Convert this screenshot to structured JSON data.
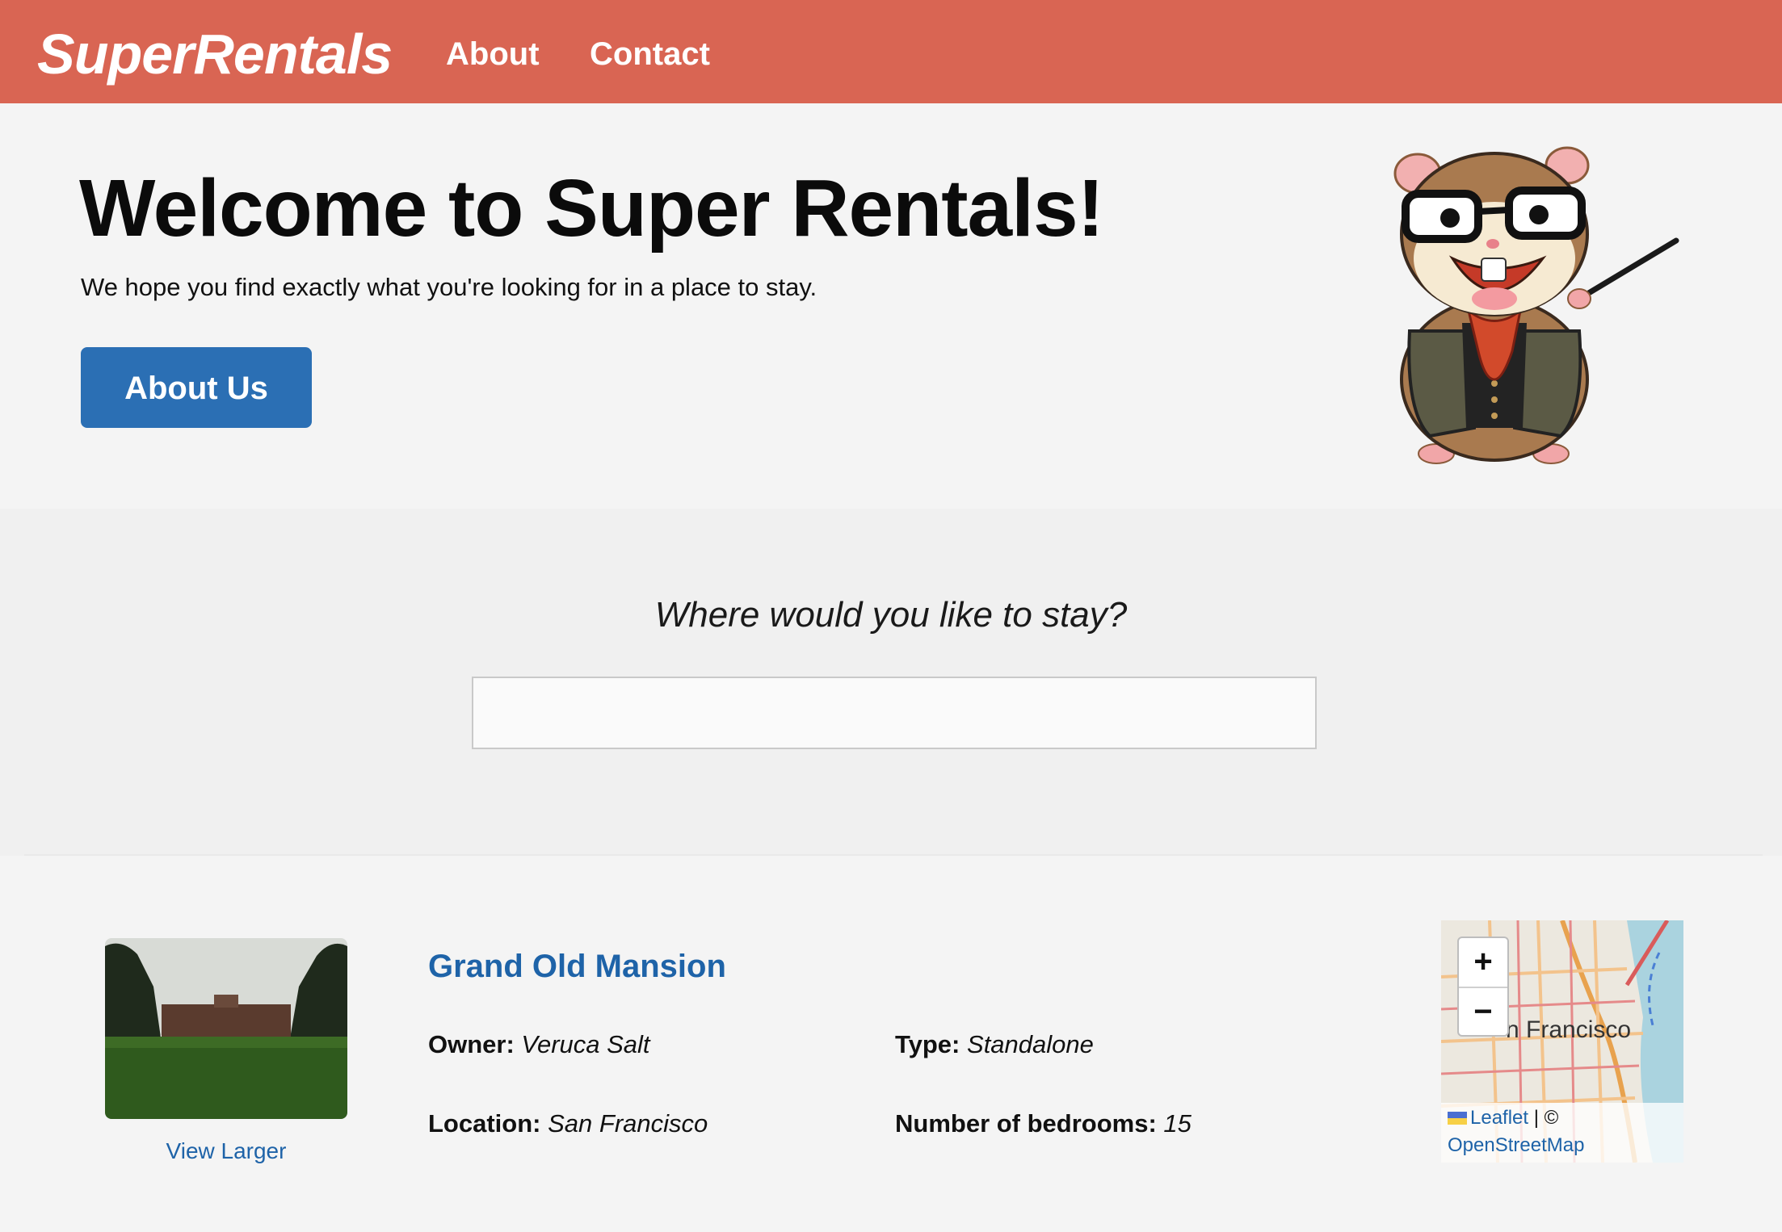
{
  "header": {
    "brand": "SuperRentals",
    "nav": [
      {
        "label": "About"
      },
      {
        "label": "Contact"
      }
    ],
    "bar_color": "#d96553"
  },
  "hero": {
    "title": "Welcome to Super Rentals!",
    "subtitle": "We hope you find exactly what you're looking for in a place to stay.",
    "button_label": "About Us",
    "button_color": "#2b6fb4",
    "mascot_icon": "tomster-mascot-illustration"
  },
  "search": {
    "prompt": "Where would you like to stay?",
    "value": "",
    "placeholder": ""
  },
  "rentals": [
    {
      "title": "Grand Old Mansion",
      "image_action": "View Larger",
      "owner_label": "Owner:",
      "owner": "Veruca Salt",
      "type_label": "Type:",
      "type": "Standalone",
      "location_label": "Location:",
      "location": "San Francisco",
      "bedrooms_label": "Number of bedrooms:",
      "bedrooms": "15",
      "map": {
        "zoom_in": "+",
        "zoom_out": "−",
        "map_label": "n Francisco",
        "attribution_leaflet": "Leaflet",
        "attribution_sep": " | © ",
        "attribution_osm": "OpenStreetMap"
      }
    }
  ],
  "colors": {
    "link": "#1e63a8",
    "background": "#f4f4f4"
  }
}
